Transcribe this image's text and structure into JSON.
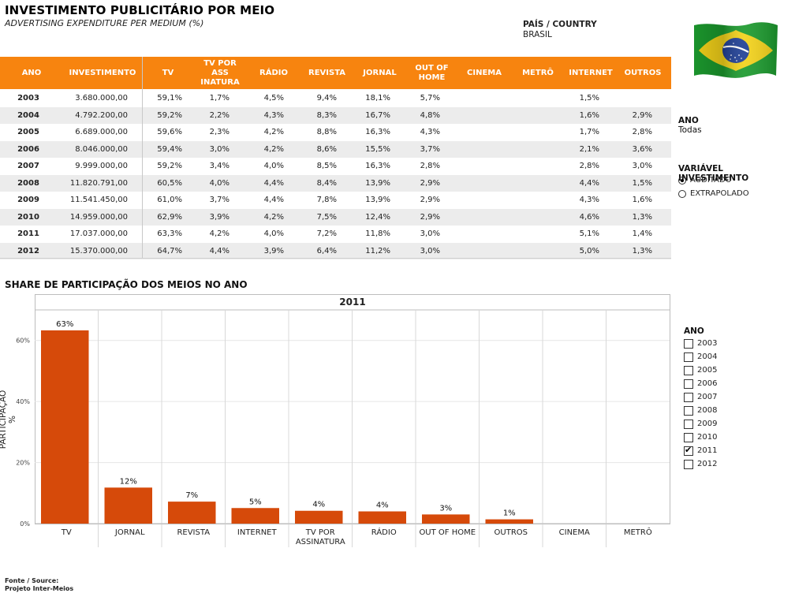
{
  "header": {
    "title": "INVESTIMENTO PUBLICITÁRIO POR MEIO",
    "subtitle": "ADVERTISING EXPENDITURE PER MEDIUM (%)",
    "country_label": "PAÍS / COUNTRY",
    "country_value": "BRASIL",
    "flag_icon": "brazil-flag-icon"
  },
  "table": {
    "headers": [
      "ANO",
      "INVESTIMENTO",
      "TV",
      "TV POR ASS INATURA",
      "RÁDIO",
      "REVISTA",
      "JORNAL",
      "OUT OF HOME",
      "CINEMA",
      "METRÔ",
      "INTERNET",
      "OUTROS"
    ],
    "header_color": "#f7840f",
    "rows": [
      [
        "2003",
        "3.680.000,00",
        "59,1%",
        "1,7%",
        "4,5%",
        "9,4%",
        "18,1%",
        "5,7%",
        "",
        "",
        "1,5%",
        ""
      ],
      [
        "2004",
        "4.792.200,00",
        "59,2%",
        "2,2%",
        "4,3%",
        "8,3%",
        "16,7%",
        "4,8%",
        "",
        "",
        "1,6%",
        "2,9%"
      ],
      [
        "2005",
        "6.689.000,00",
        "59,6%",
        "2,3%",
        "4,2%",
        "8,8%",
        "16,3%",
        "4,3%",
        "",
        "",
        "1,7%",
        "2,8%"
      ],
      [
        "2006",
        "8.046.000,00",
        "59,4%",
        "3,0%",
        "4,2%",
        "8,6%",
        "15,5%",
        "3,7%",
        "",
        "",
        "2,1%",
        "3,6%"
      ],
      [
        "2007",
        "9.999.000,00",
        "59,2%",
        "3,4%",
        "4,0%",
        "8,5%",
        "16,3%",
        "2,8%",
        "",
        "",
        "2,8%",
        "3,0%"
      ],
      [
        "2008",
        "11.820.791,00",
        "60,5%",
        "4,0%",
        "4,4%",
        "8,4%",
        "13,9%",
        "2,9%",
        "",
        "",
        "4,4%",
        "1,5%"
      ],
      [
        "2009",
        "11.541.450,00",
        "61,0%",
        "3,7%",
        "4,4%",
        "7,8%",
        "13,9%",
        "2,9%",
        "",
        "",
        "4,3%",
        "1,6%"
      ],
      [
        "2010",
        "14.959.000,00",
        "62,9%",
        "3,9%",
        "4,2%",
        "7,5%",
        "12,4%",
        "2,9%",
        "",
        "",
        "4,6%",
        "1,3%"
      ],
      [
        "2011",
        "17.037.000,00",
        "63,3%",
        "4,2%",
        "4,0%",
        "7,2%",
        "11,8%",
        "3,0%",
        "",
        "",
        "5,1%",
        "1,4%"
      ],
      [
        "2012",
        "15.370.000,00",
        "64,7%",
        "4,4%",
        "3,9%",
        "6,4%",
        "11,2%",
        "3,0%",
        "",
        "",
        "5,0%",
        "1,3%"
      ]
    ]
  },
  "filters": {
    "ano_label": "ANO",
    "ano_value": "Todas",
    "variavel_label": "VARIÁVEL INVESTIMENTO",
    "options": [
      {
        "label": "AUDITADO",
        "selected": true
      },
      {
        "label": "EXTRAPOLADO",
        "selected": false
      }
    ]
  },
  "chart_section_title": "SHARE DE PARTICIPAÇÃO DOS MEIOS NO ANO",
  "chart_data": {
    "type": "bar",
    "title": "2011",
    "ylabel": "PARTICIPAÇÃO %",
    "ylim": [
      0,
      70
    ],
    "yticks": [
      "0%",
      "20%",
      "40%",
      "60%"
    ],
    "ytick_values": [
      0,
      20,
      40,
      60
    ],
    "categories": [
      "TV",
      "JORNAL",
      "REVISTA",
      "INTERNET",
      "TV POR ASSINATURA",
      "RÁDIO",
      "OUT OF HOME",
      "OUTROS",
      "CINEMA",
      "METRÔ"
    ],
    "category_labels": [
      [
        "TV"
      ],
      [
        "JORNAL"
      ],
      [
        "REVISTA"
      ],
      [
        "INTERNET"
      ],
      [
        "TV POR",
        "ASSINATURA"
      ],
      [
        "RÁDIO"
      ],
      [
        "OUT OF HOME"
      ],
      [
        "OUTROS"
      ],
      [
        "CINEMA"
      ],
      [
        "METRÔ"
      ]
    ],
    "values": [
      63.3,
      11.8,
      7.2,
      5.1,
      4.2,
      4.0,
      3.0,
      1.4,
      null,
      null
    ],
    "data_labels": [
      "63%",
      "12%",
      "7%",
      "5%",
      "4%",
      "4%",
      "3%",
      "1%",
      "",
      ""
    ],
    "bar_color": "#d64a0a",
    "grid": true
  },
  "legend": {
    "title": "ANO",
    "years": [
      {
        "label": "2003",
        "checked": false
      },
      {
        "label": "2004",
        "checked": false
      },
      {
        "label": "2005",
        "checked": false
      },
      {
        "label": "2006",
        "checked": false
      },
      {
        "label": "2007",
        "checked": false
      },
      {
        "label": "2008",
        "checked": false
      },
      {
        "label": "2009",
        "checked": false
      },
      {
        "label": "2010",
        "checked": false
      },
      {
        "label": "2011",
        "checked": true
      },
      {
        "label": "2012",
        "checked": false
      }
    ]
  },
  "source": {
    "line1": "Fonte / Source:",
    "line2": "Projeto Inter-Meios"
  }
}
